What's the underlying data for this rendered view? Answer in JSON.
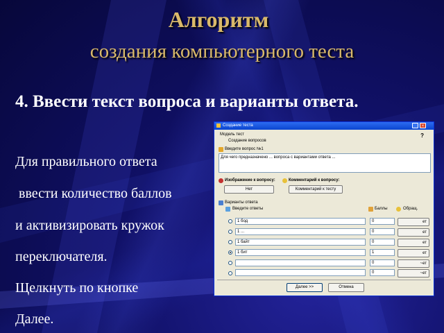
{
  "slide": {
    "title_line1": "Алгоритм",
    "title_line2": "создания  компьютерного теста",
    "step_heading": "4. Ввести текст вопроса и варианты ответа.",
    "lines": [
      "Для правильного ответа",
      " ввести количество баллов",
      "и активизировать кружок",
      "переключателя.",
      "Щелкнуть по кнопке",
      "Далее."
    ]
  },
  "dialog": {
    "title": "Создание теста",
    "test_name_label": "Модель тест",
    "test_subname": "Создание вопросов",
    "question_label": "Введите вопрос №1",
    "question_text": "Для чего предназначено ... вопроса с вариантами ответа ...",
    "image_label": "Изображение к вопросу:",
    "image_button": "Нет",
    "comment_label": "Комментарий к вопросу:",
    "comment_button": "Комментарий к тесту",
    "answers_header": "Варианты ответа",
    "answers_col_label": "Введите ответы",
    "points_label": "Баллы",
    "comment_col_label": "Обращ.",
    "answers": [
      {
        "text": "1 бод",
        "points": "0",
        "selected": false,
        "btn": "ет"
      },
      {
        "text": "1 ...",
        "points": "0",
        "selected": false,
        "btn": "ет"
      },
      {
        "text": "1 байт",
        "points": "0",
        "selected": false,
        "btn": "ет"
      },
      {
        "text": "1 бит",
        "points": "1",
        "selected": true,
        "btn": "ет"
      },
      {
        "text": "",
        "points": "0",
        "selected": false,
        "btn": "~ет"
      },
      {
        "text": "",
        "points": "0",
        "selected": false,
        "btn": "~ет"
      }
    ],
    "next_button": "Далее >>",
    "cancel_button": "Отмена"
  },
  "colors": {
    "background": "#0d0d5c",
    "title_gold": "#d9b96a",
    "dialog_titlebar": "#0a45d0",
    "dialog_body": "#ece9d8"
  }
}
